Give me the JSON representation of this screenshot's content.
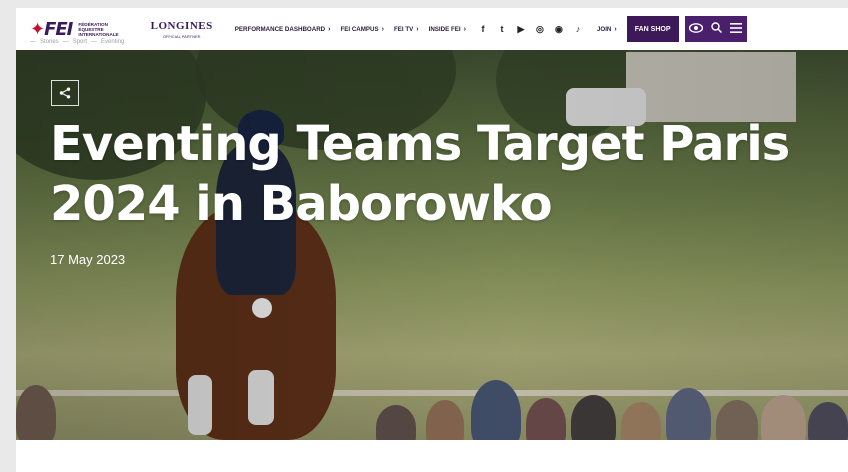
{
  "header": {
    "logo_mark": "FEI",
    "logo_sub": [
      "FÉDÉRATION",
      "ÉQUESTRE",
      "INTERNATIONALE"
    ],
    "sponsor_name": "LONGINES",
    "sponsor_sub": "OFFICIAL PARTNER",
    "nav": [
      {
        "label": "PERFORMANCE DASHBOARD"
      },
      {
        "label": "FEI CAMPUS"
      },
      {
        "label": "FEI TV"
      },
      {
        "label": "INSIDE FEI"
      }
    ],
    "social": [
      "f",
      "t",
      "▶",
      "◎",
      "◉",
      "♪"
    ],
    "join_label": "JOIN",
    "fanshop_label": "FAN SHOP"
  },
  "breadcrumb": [
    "—",
    "Stories",
    "—",
    "Sport",
    "—",
    "Eventing"
  ],
  "hero": {
    "title": "Eventing Teams Target Paris 2024 in Baborowko",
    "date": "17 May 2023"
  },
  "colors": {
    "brand_purple": "#3d1959",
    "accent_red": "#c8102e"
  }
}
